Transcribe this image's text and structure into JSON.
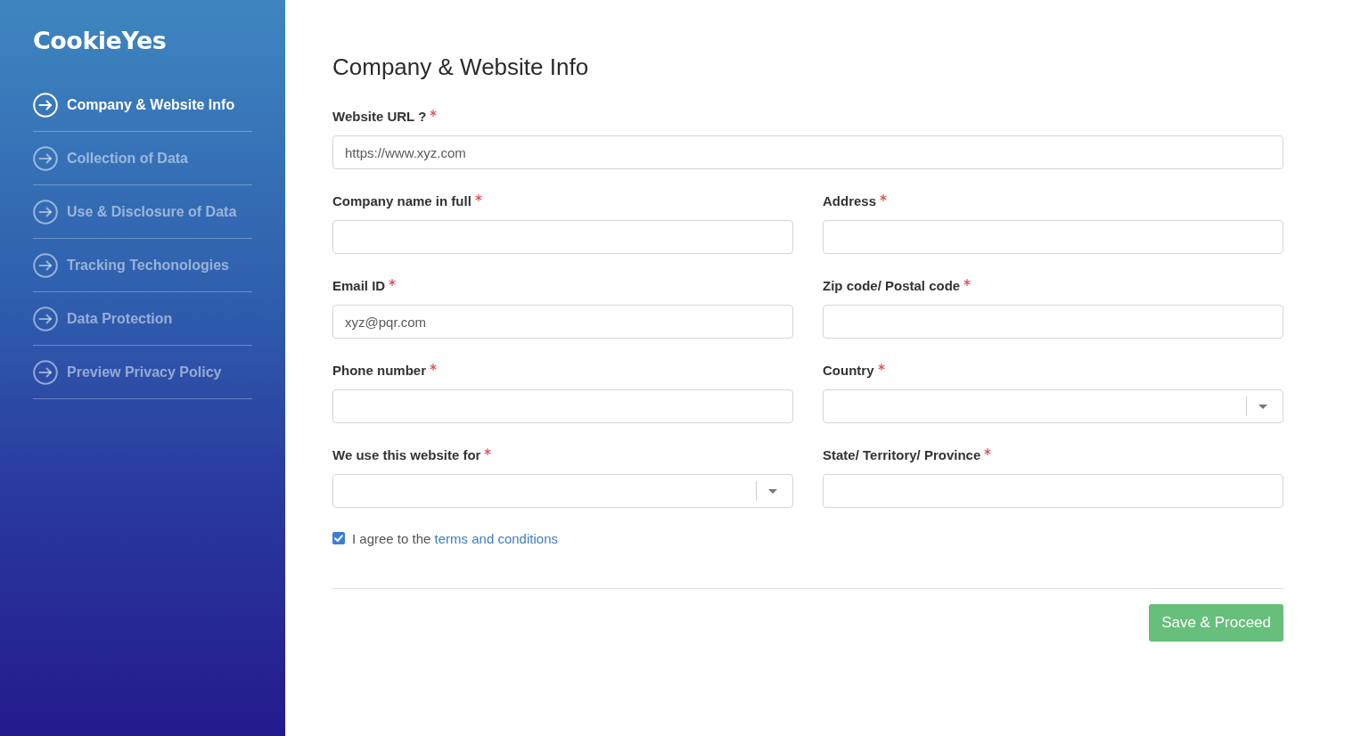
{
  "sidebar": {
    "logo": "CookieYes",
    "items": [
      {
        "label": "Company & Website Info",
        "selected": true
      },
      {
        "label": "Collection of Data",
        "selected": false
      },
      {
        "label": "Use & Disclosure of Data",
        "selected": false
      },
      {
        "label": "Tracking Techonologies",
        "selected": false
      },
      {
        "label": "Data Protection",
        "selected": false
      },
      {
        "label": "Preview Privacy Policy",
        "selected": false
      }
    ]
  },
  "form": {
    "title": "Company & Website Info",
    "url_field": {
      "label": "Website URL ?",
      "required": true,
      "kind": "text",
      "placeholder": "https://www.xyz.com"
    },
    "fields": [
      {
        "label": "Company name in full",
        "required": true,
        "kind": "text"
      },
      {
        "label": "Address",
        "required": true,
        "kind": "text"
      },
      {
        "label": "Email ID",
        "required": true,
        "kind": "text",
        "placeholder": "xyz@pqr.com"
      },
      {
        "label": "Zip code/ Postal code",
        "required": true,
        "kind": "text"
      },
      {
        "label": "Phone number",
        "required": true,
        "kind": "text"
      },
      {
        "label": "Country",
        "required": true,
        "kind": "select"
      },
      {
        "label": "We use this website for",
        "required": true,
        "kind": "select"
      },
      {
        "label": "State/ Territory/ Province",
        "required": true,
        "kind": "text"
      }
    ],
    "agreement": {
      "checked": true,
      "text": "I agree to the",
      "link": "terms and conditions"
    },
    "submit_button": "Save & Proceed"
  }
}
